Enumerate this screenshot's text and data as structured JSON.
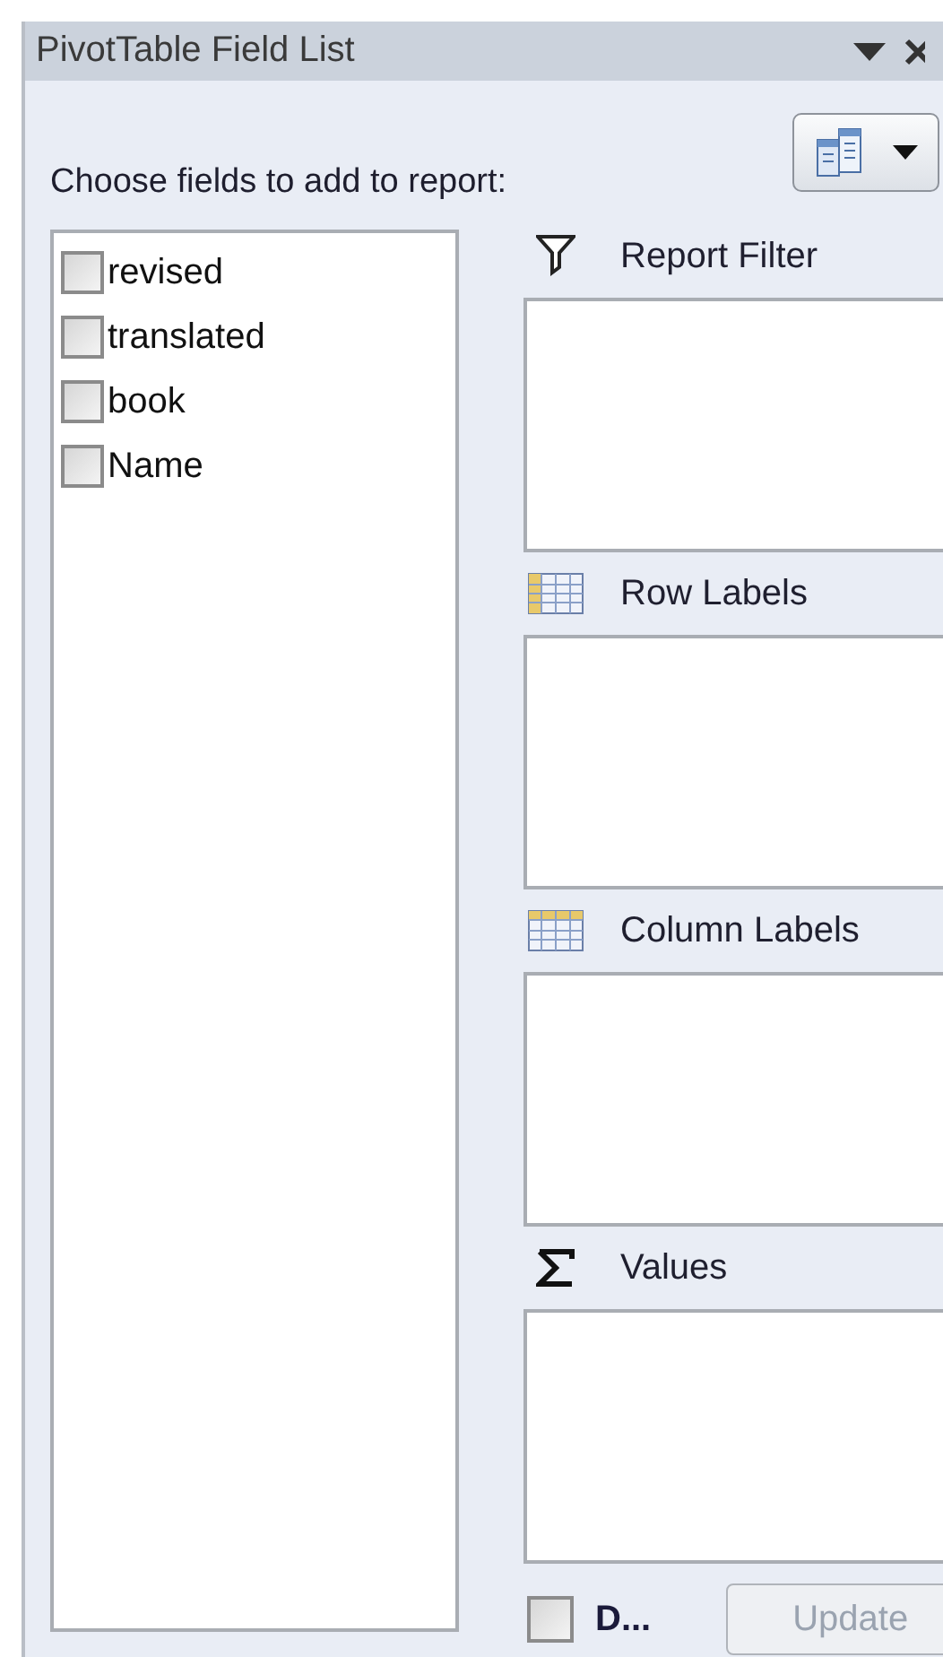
{
  "window": {
    "title": "PivotTable Field List"
  },
  "prompt": "Choose fields to add to report:",
  "fields": [
    {
      "label": "revised",
      "checked": false
    },
    {
      "label": "translated",
      "checked": false
    },
    {
      "label": "book",
      "checked": false
    },
    {
      "label": "Name",
      "checked": false
    }
  ],
  "areas": [
    {
      "kind": "filter",
      "label": "Report Filter"
    },
    {
      "kind": "rows",
      "label": "Row Labels"
    },
    {
      "kind": "columns",
      "label": "Column Labels"
    },
    {
      "kind": "values",
      "label": "Values"
    }
  ],
  "defer": {
    "label": "D...",
    "checked": false
  },
  "update_button": {
    "label": "Update",
    "disabled": true
  }
}
